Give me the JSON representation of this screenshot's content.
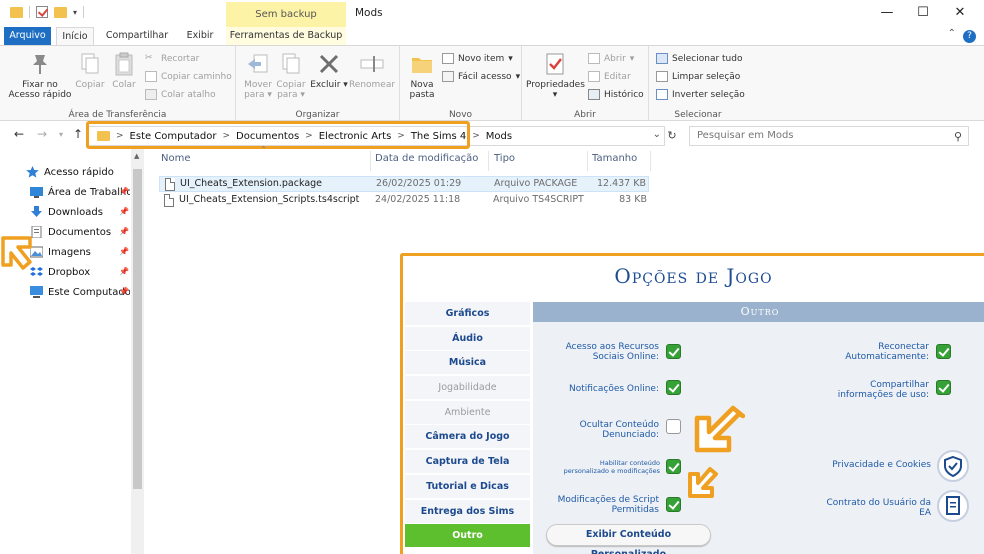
{
  "window": {
    "title": "Mods",
    "context_tab_group": "Sem backup",
    "minimize_glyph": "—",
    "maximize_glyph": "☐",
    "close_glyph": "✕"
  },
  "ribbon_tabs": {
    "file": "Arquivo",
    "home": "Início",
    "share": "Compartilhar",
    "view": "Exibir",
    "tools": "Ferramentas de Backup"
  },
  "ribbon": {
    "clipboard": {
      "label": "Área de Transferência",
      "pin": "Fixar no Acesso rápido",
      "copy": "Copiar",
      "paste": "Colar",
      "cut": "Recortar",
      "copy_path": "Copiar caminho",
      "paste_shortcut": "Colar atalho"
    },
    "organize": {
      "label": "Organizar",
      "move": "Mover para",
      "copy_to": "Copiar para",
      "delete": "Excluir",
      "rename": "Renomear"
    },
    "new": {
      "label": "Novo",
      "new_folder": "Nova pasta",
      "new_item": "Novo item",
      "easy_access": "Fácil acesso"
    },
    "open": {
      "label": "Abrir",
      "properties": "Propriedades",
      "open": "Abrir",
      "edit": "Editar",
      "history": "Histórico"
    },
    "select": {
      "label": "Selecionar",
      "select_all": "Selecionar tudo",
      "select_none": "Limpar seleção",
      "invert": "Inverter seleção"
    }
  },
  "address": {
    "crumbs": [
      "Este Computador",
      "Documentos",
      "Electronic Arts",
      "The Sims 4",
      "Mods"
    ],
    "search_placeholder": "Pesquisar em Mods",
    "separator": ">"
  },
  "nav_pane": {
    "items": [
      {
        "label": "Acesso rápido",
        "icon": "star-icon"
      },
      {
        "label": "Área de Trabalho",
        "icon": "desktop-icon"
      },
      {
        "label": "Downloads",
        "icon": "download-icon"
      },
      {
        "label": "Documentos",
        "icon": "document-icon"
      },
      {
        "label": "Imagens",
        "icon": "pictures-icon"
      },
      {
        "label": "Dropbox",
        "icon": "dropbox-icon"
      },
      {
        "label": "Este Computador",
        "icon": "computer-icon"
      }
    ]
  },
  "file_list": {
    "columns": [
      "Nome",
      "Data de modificação",
      "Tipo",
      "Tamanho"
    ],
    "rows": [
      {
        "name": "UI_Cheats_Extension.package",
        "date": "26/02/2025 01:29",
        "type": "Arquivo PACKAGE",
        "size": "12.437 KB"
      },
      {
        "name": "UI_Cheats_Extension_Scripts.ts4script",
        "date": "24/02/2025 11:18",
        "type": "Arquivo TS4SCRIPT",
        "size": "83 KB"
      }
    ]
  },
  "game_options": {
    "title": "Opções de Jogo",
    "menu": [
      {
        "label": "Gráficos",
        "state": "normal"
      },
      {
        "label": "Áudio",
        "state": "normal"
      },
      {
        "label": "Música",
        "state": "normal"
      },
      {
        "label": "Jogabilidade",
        "state": "dim"
      },
      {
        "label": "Ambiente",
        "state": "dim"
      },
      {
        "label": "Câmera do Jogo",
        "state": "normal"
      },
      {
        "label": "Captura de Tela",
        "state": "normal"
      },
      {
        "label": "Tutorial e Dicas",
        "state": "normal"
      },
      {
        "label": "Entrega dos Sims",
        "state": "normal"
      },
      {
        "label": "Outro",
        "state": "active"
      }
    ],
    "section": "Outro",
    "options": {
      "social": {
        "line1": "Acesso aos Recursos",
        "line2": "Sociais Online:",
        "checked": true
      },
      "notifications": {
        "line1": "Notificações Online:",
        "checked": true
      },
      "hide_reported": {
        "line1": "Ocultar Conteúdo",
        "line2": "Denunciado:",
        "checked": false
      },
      "enable_cc": {
        "line1": "Habilitar conteúdo",
        "line2": "personalizado e modificações",
        "checked": true
      },
      "script_mods": {
        "line1": "Modificações de Script",
        "line2": "Permitidas",
        "checked": true
      },
      "reconnect": {
        "line1": "Reconectar",
        "line2": "Automaticamente:",
        "checked": true
      },
      "share_usage": {
        "line1": "Compartilhar",
        "line2": "informações de uso:",
        "checked": true
      },
      "privacy": {
        "line1": "Privacidade e Cookies"
      },
      "eula": {
        "line1": "Contrato do Usuário da",
        "line2": "EA"
      }
    },
    "show_cc_button": "Exibir Conteúdo Personalizado"
  },
  "colors": {
    "highlight": "#f0a021",
    "sims_blue": "#1d4a8e",
    "sims_green": "#5dbf2e",
    "win_blue": "#1e6fc3"
  }
}
